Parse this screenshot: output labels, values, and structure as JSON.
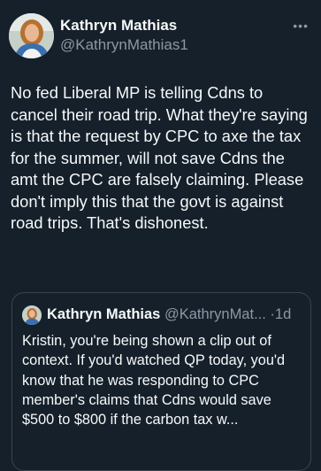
{
  "author": {
    "name": "Kathryn Mathias",
    "handle": "@KathrynMathias1"
  },
  "menu_icon": "more-horizontal-icon",
  "more_glyph": "•••",
  "tweet_text": "No fed Liberal MP is telling Cdns to cancel their road trip. What they're saying is that the request by CPC to axe the tax for the summer, will not save Cdns the amt the CPC are falsely claiming. Please don't imply this that the govt is against road trips. That's dishonest.",
  "quoted": {
    "name": "Kathryn Mathias",
    "handle_truncated": "@KathrynMat...",
    "separator": "·",
    "time": "1d",
    "text": "Kristin, you're being shown a clip out of context. If you'd watched QP today, you'd know that he was responding to CPC member's claims that Cdns would save $500 to $800 if the carbon tax w..."
  },
  "colors": {
    "background": "#15202b",
    "text": "#f7f9f9",
    "muted": "#8b98a5",
    "border": "#38444d"
  }
}
